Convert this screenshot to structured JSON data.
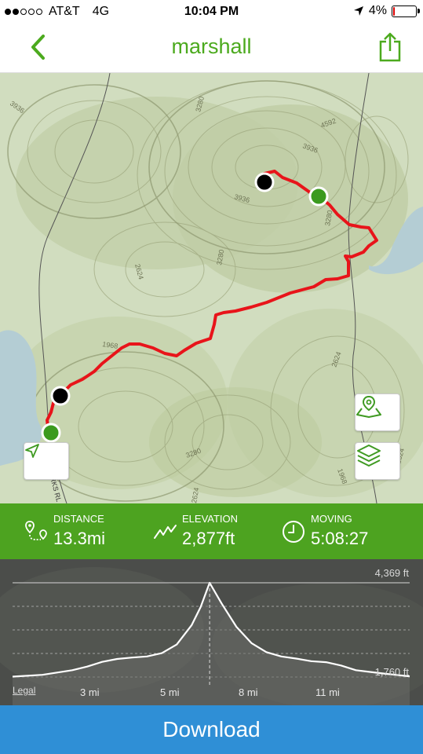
{
  "status_bar": {
    "carrier": "AT&T",
    "network": "4G",
    "time": "10:04 PM",
    "battery": "4%",
    "battery_level": 0.04
  },
  "header": {
    "title": "marshall",
    "back_icon": "chevron-left-icon",
    "share_icon": "share-icon"
  },
  "colors": {
    "brand_green": "#4da320",
    "route_red": "#e8141a",
    "download_blue": "#2f8fd6"
  },
  "map": {
    "contour_labels": [
      "3936",
      "3280",
      "4592",
      "3936",
      "3936",
      "3280",
      "3280",
      "2624",
      "2624",
      "1968",
      "3280",
      "2624",
      "1968",
      "2624"
    ],
    "road_label": "RKS RL",
    "locate_icon": "location-arrow-icon",
    "track_view_icon": "map-pin-icon",
    "layers_icon": "layers-icon"
  },
  "stats": [
    {
      "label": "DISTANCE",
      "value": "13.3mi",
      "icon": "route-pin-icon"
    },
    {
      "label": "ELEVATION",
      "value": "2,877ft",
      "icon": "elevation-zigzag-icon"
    },
    {
      "label": "MOVING",
      "value": "5:08:27",
      "icon": "clock-icon"
    }
  ],
  "elevation_chart": {
    "chart_data": {
      "type": "area",
      "xlabel": "",
      "ylabel": "",
      "x_ticks": [
        "3 mi",
        "5 mi",
        "8 mi",
        "11 mi"
      ],
      "y_ticks": [
        "4,369 ft",
        "1,760 ft"
      ],
      "ylim": [
        1760,
        4369
      ],
      "x": [
        0,
        1,
        2,
        2.5,
        3,
        3.5,
        4,
        4.5,
        5,
        5.5,
        6,
        6.3,
        6.6,
        7,
        7.5,
        8,
        8.5,
        9,
        9.5,
        10,
        10.5,
        11,
        11.5,
        12,
        12.5,
        13.3
      ],
      "y": [
        1770,
        1820,
        1950,
        2050,
        2180,
        2260,
        2300,
        2330,
        2420,
        2660,
        3200,
        3700,
        4369,
        3800,
        3150,
        2700,
        2450,
        2330,
        2270,
        2200,
        2170,
        2080,
        1950,
        1900,
        1850,
        1780
      ],
      "grid": true,
      "marker_x": 6.6
    },
    "legal_label": "Legal"
  },
  "download_button": {
    "label": "Download"
  }
}
